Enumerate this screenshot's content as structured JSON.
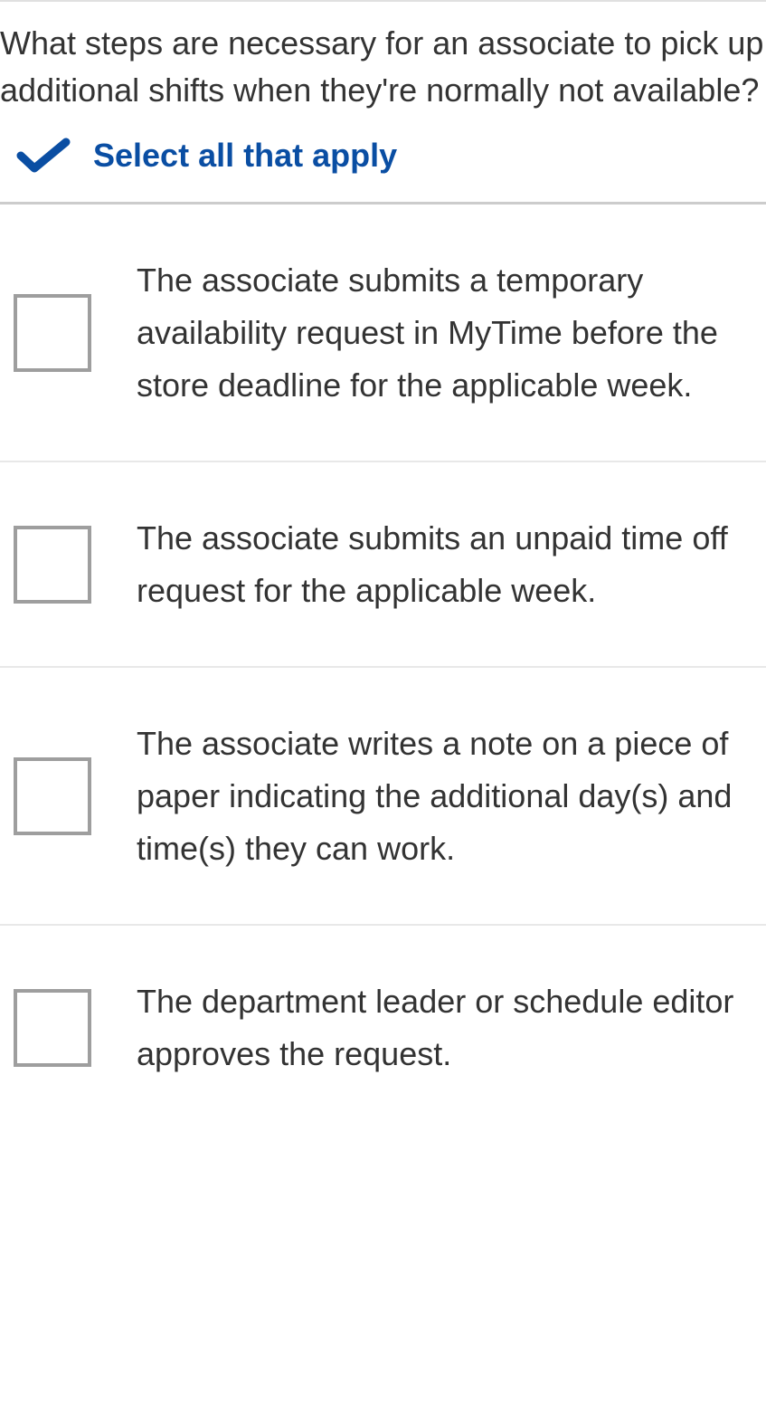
{
  "question": {
    "text": "What steps are necessary for an associate to pick up additional shifts when they're normally not available?",
    "instruction": "Select all that apply"
  },
  "options": [
    {
      "label": "The associate submits a temporary availability request in MyTime before the store deadline for the applicable week."
    },
    {
      "label": "The associate submits an unpaid time off request for the applicable week."
    },
    {
      "label": "The associate writes a note on a piece of paper indicating the additional day(s) and time(s) they can work."
    },
    {
      "label": "The department leader or schedule editor approves the request."
    }
  ],
  "colors": {
    "accent": "#0a4ea3",
    "text": "#333333",
    "checkbox_border": "#9e9e9e",
    "divider": "#e0e0e0"
  }
}
